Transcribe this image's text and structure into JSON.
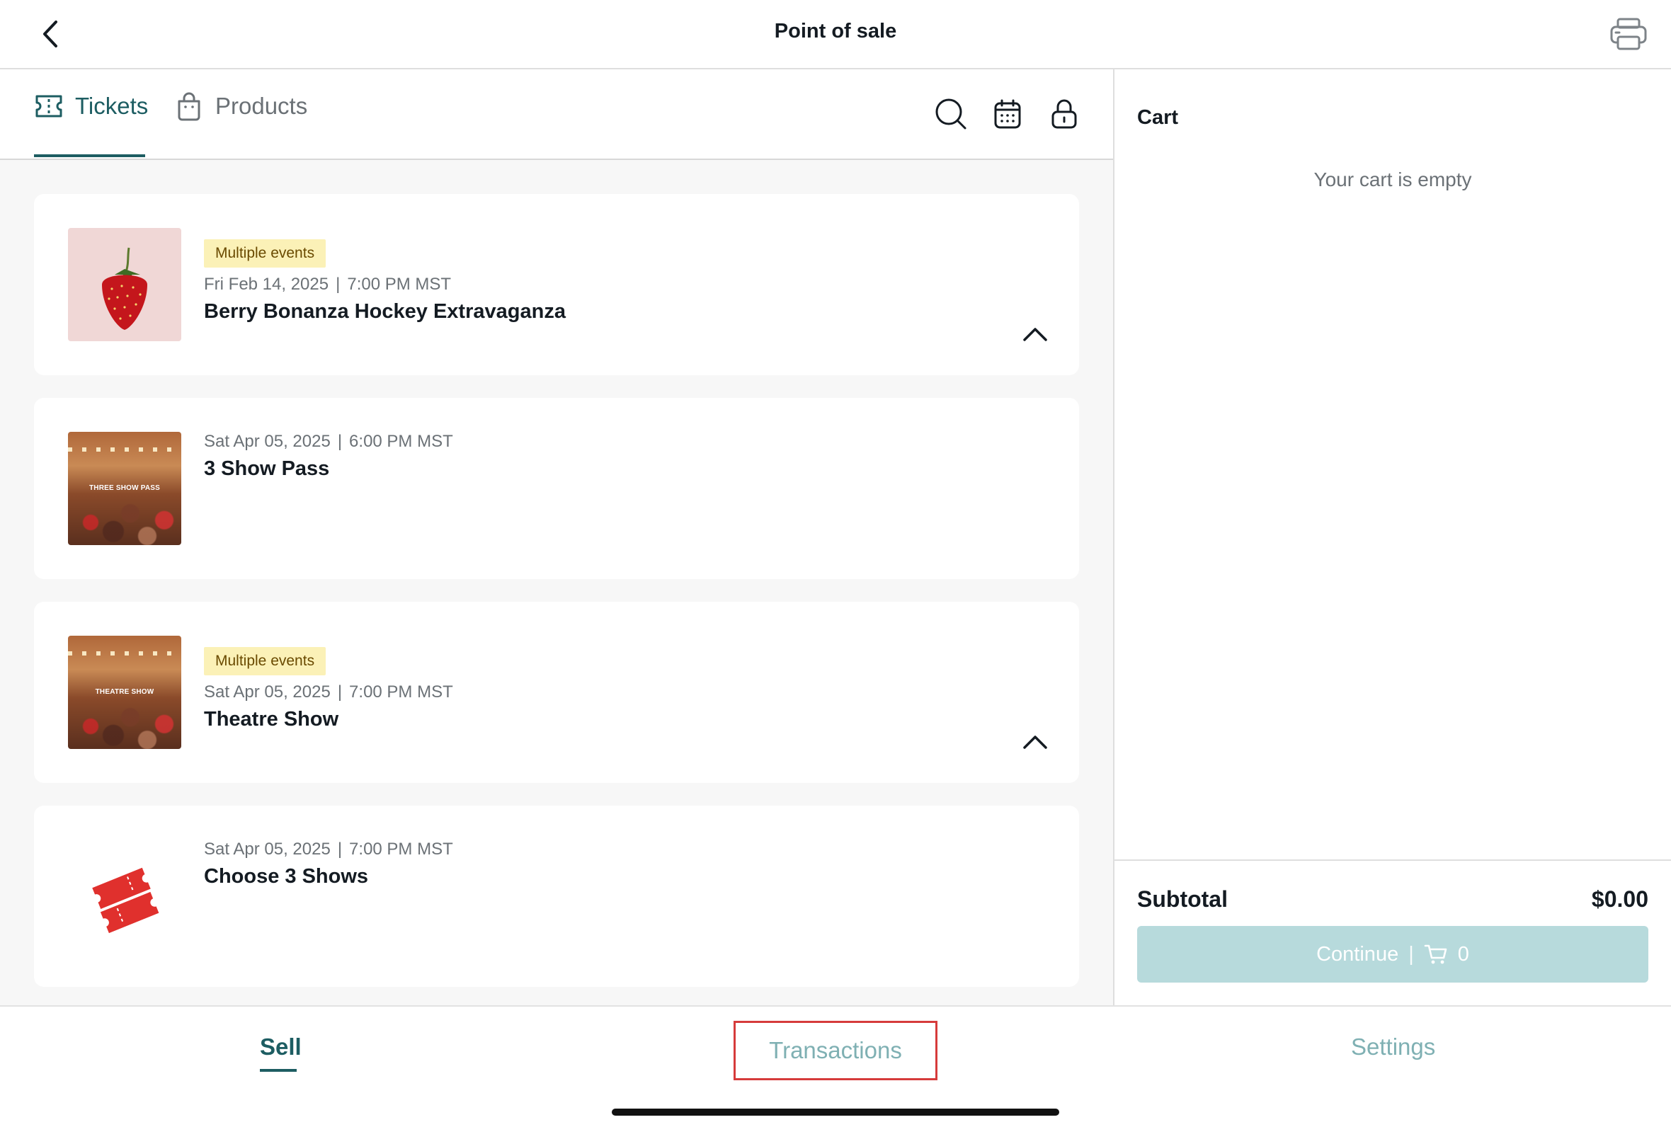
{
  "header": {
    "title": "Point of sale"
  },
  "tabs": [
    {
      "label": "Tickets",
      "active": true
    },
    {
      "label": "Products",
      "active": false
    }
  ],
  "toolbar": {
    "icons": [
      "search-icon",
      "calendar-icon",
      "lock-icon"
    ]
  },
  "events": [
    {
      "badge": "Multiple events",
      "date": "Fri Feb 14, 2025",
      "time": "7:00 PM MST",
      "name": "Berry Bonanza Hockey Extravaganza",
      "expandable": true,
      "image": "strawberry"
    },
    {
      "badge": "",
      "date": "Sat Apr 05, 2025",
      "time": "6:00 PM MST",
      "name": "3 Show Pass",
      "expandable": false,
      "image": "crowd",
      "image_text": "THREE SHOW PASS"
    },
    {
      "badge": "Multiple events",
      "date": "Sat Apr 05, 2025",
      "time": "7:00 PM MST",
      "name": "Theatre Show",
      "expandable": true,
      "image": "crowd",
      "image_text": "THEATRE SHOW"
    },
    {
      "badge": "",
      "date": "Sat Apr 05, 2025",
      "time": "7:00 PM MST",
      "name": "Choose 3 Shows",
      "expandable": false,
      "image": "tickets"
    }
  ],
  "date_separator": "|",
  "cart": {
    "title": "Cart",
    "empty_message": "Your cart is empty",
    "subtotal_label": "Subtotal",
    "subtotal_value": "$0.00",
    "continue_label": "Continue",
    "continue_separator": "|",
    "item_count": "0"
  },
  "bottom_nav": {
    "sell": "Sell",
    "transactions": "Transactions",
    "settings": "Settings"
  },
  "colors": {
    "accent": "#1d5d62",
    "muted_accent": "#7fb0b3",
    "badge_bg": "#fbf1b7",
    "button_disabled": "#b7dadc",
    "highlight": "#d63b3b"
  }
}
